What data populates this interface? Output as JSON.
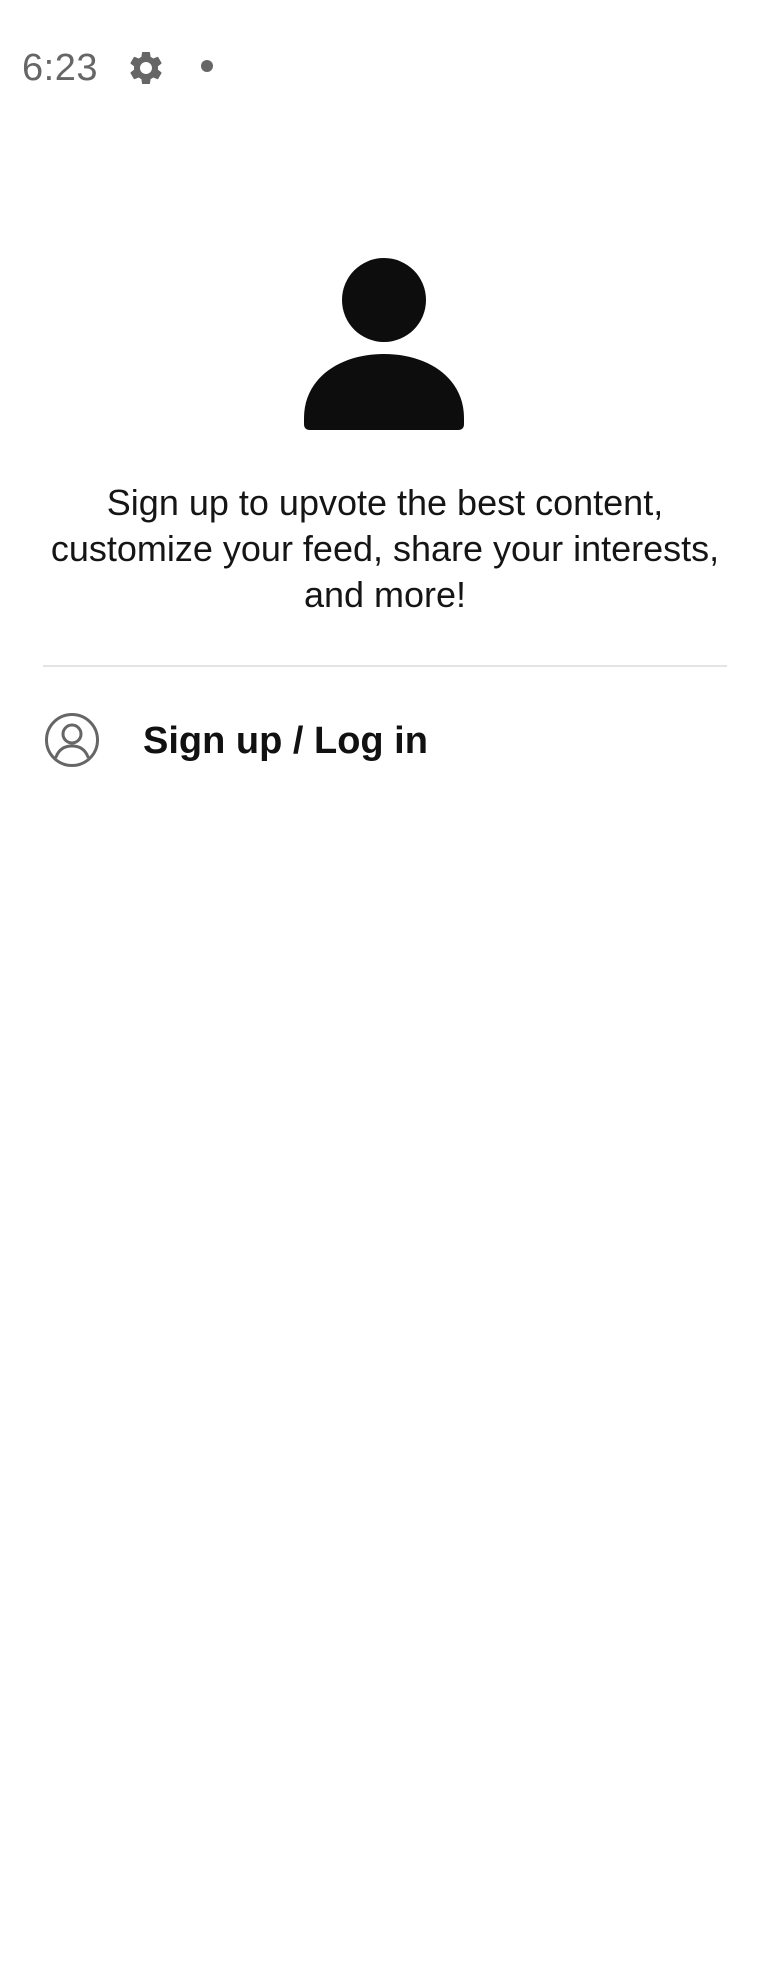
{
  "status_bar": {
    "time": "6:23",
    "icons": [
      "gear-icon",
      "notification-dot-icon"
    ]
  },
  "profile": {
    "avatar_icon": "person-icon",
    "prompt_text": "Sign up to upvote the best content, customize your feed, share your interests, and more!"
  },
  "menu": {
    "login_icon": "account-circle-icon",
    "login_label": "Sign up / Log in"
  },
  "colors": {
    "background": "#ffffff",
    "primary_text": "#111111",
    "secondary_text": "#666666",
    "divider": "#e4e4e4"
  }
}
